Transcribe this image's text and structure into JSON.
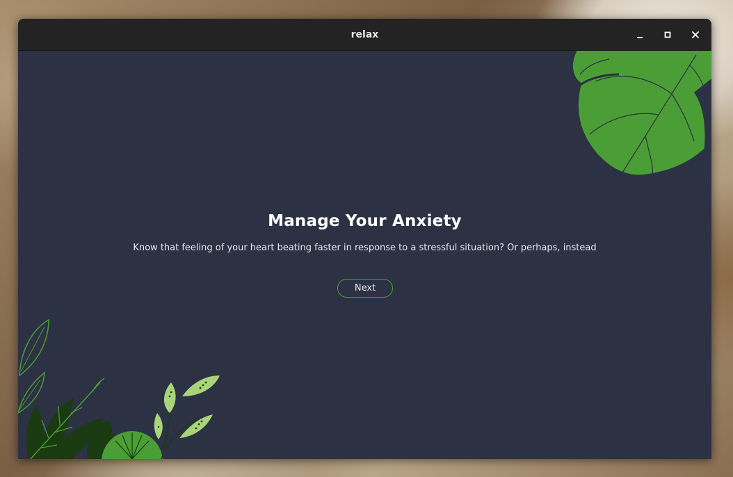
{
  "window": {
    "title": "relax",
    "controls": {
      "minimize_icon": "window-minimize-icon",
      "maximize_icon": "window-maximize-icon",
      "close_icon": "window-close-icon"
    }
  },
  "onboarding": {
    "heading": "Manage Your Anxiety",
    "body": "Know that feeling of your heart beating faster in response to a stressful situation? Or perhaps, instead",
    "next_label": "Next"
  },
  "colors": {
    "window_background": "#2c3143",
    "titlebar": "#232323",
    "leaf_green": "#4a9e35",
    "light_leaf": "#a9d47a",
    "dark_leaf": "#1a3a12",
    "button_border": "#53a03f"
  }
}
